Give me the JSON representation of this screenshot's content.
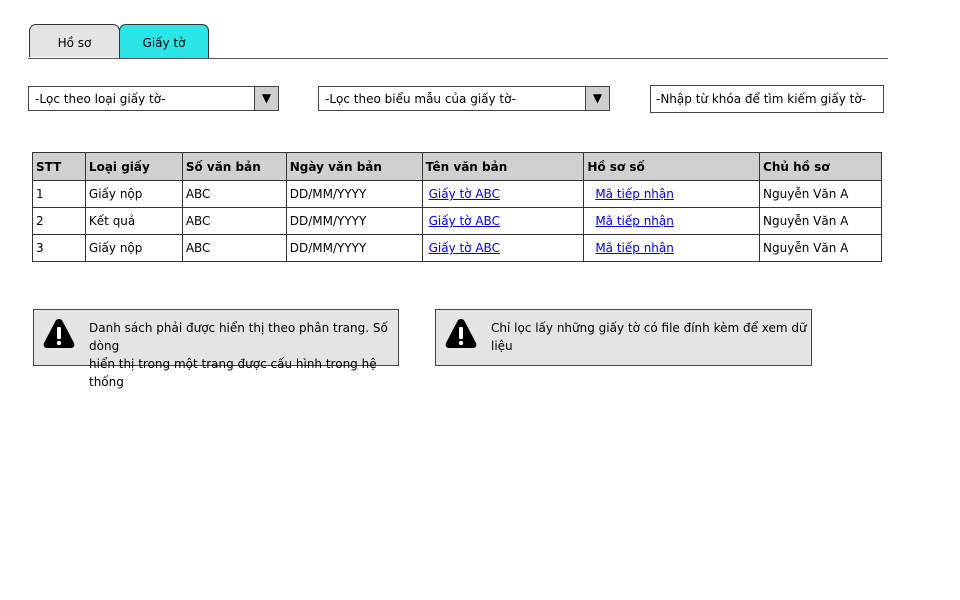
{
  "tabs": [
    {
      "label": "Hồ sơ",
      "active": false
    },
    {
      "label": "Giấy tờ",
      "active": true
    }
  ],
  "filters": {
    "type_filter": {
      "value": "-Lọc theo loại giấy tờ-"
    },
    "template_filter": {
      "value": "-Lọc theo biểu mẫu của giấy tờ-"
    },
    "search": {
      "placeholder": "-Nhập từ khóa để tìm kiếm giấy tờ-"
    }
  },
  "table": {
    "headers": [
      "STT",
      "Loại giấy",
      "Số văn bản",
      "Ngày văn bản",
      "Tên văn bản",
      "Hồ sơ số",
      "Chủ hồ sơ"
    ],
    "rows": [
      [
        "1",
        "Giấy nộp",
        "ABC",
        "DD/MM/YYYY",
        "Giấy tờ ABC",
        "Mã tiếp nhận",
        "Nguyễn Văn A"
      ],
      [
        "2",
        "Kết quả",
        "ABC",
        "DD/MM/YYYY",
        "Giấy tờ ABC",
        "Mã tiếp nhận",
        "Nguyễn Văn A"
      ],
      [
        "3",
        "Giấy nộp",
        "ABC",
        "DD/MM/YYYY",
        "Giấy tờ ABC",
        "Mã tiếp nhận",
        "Nguyễn Văn A"
      ]
    ]
  },
  "notes": [
    {
      "line1": "Danh sách phải được hiển thị theo phân trang. Số dòng",
      "line2": "hiển thị trong một trang được cấu hình trong hệ thống"
    },
    {
      "line1": "Chỉ lọc lấy những giấy tờ có file đính kèm để xem dữ liệu",
      "line2": ""
    }
  ],
  "colors": {
    "active_tab": "#2ae6e6",
    "link": "#0000e0",
    "header_bg": "#d0d0d0",
    "note_bg": "#e4e4e4"
  },
  "icons": {
    "dropdown": "triangle-down-icon",
    "note": "warning-icon"
  }
}
